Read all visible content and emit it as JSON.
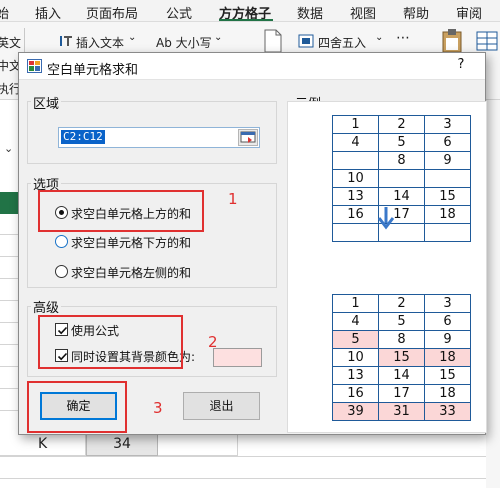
{
  "ribbon": {
    "tabs": [
      "始",
      "插入",
      "页面布局",
      "公式",
      "方方格子",
      "数据",
      "视图",
      "帮助",
      "审阅"
    ],
    "active_tab": "方方格子",
    "buttons": {
      "insert_text": "插入文本",
      "case": "Ab 大小写",
      "round": "四舍五入"
    },
    "left_labels": [
      "英文",
      "中文",
      "执行"
    ]
  },
  "sheet": {
    "cell_label": "K",
    "cell_value": "34"
  },
  "dialog": {
    "title": "空白单元格求和",
    "help": "?",
    "range_group_label": "区域",
    "range_value": "C2:C12",
    "options_group_label": "选项",
    "options": [
      {
        "label": "求空白单元格上方的和",
        "selected": true
      },
      {
        "label": "求空白单元格下方的和",
        "selected": false
      },
      {
        "label": "求空白单元格左侧的和",
        "selected": false
      }
    ],
    "advanced_group_label": "高级",
    "use_formula_label": "使用公式",
    "use_formula_checked": true,
    "set_bg_label": "同时设置其背景颜色为:",
    "set_bg_checked": true,
    "bg_color": "#fde0e0",
    "ok_label": "确定",
    "cancel_label": "退出",
    "example_label": "示例",
    "annotations": [
      "1",
      "2",
      "3"
    ]
  },
  "example": {
    "before": [
      [
        "1",
        "2",
        "3"
      ],
      [
        "4",
        "5",
        "6"
      ],
      [
        "",
        "8",
        "9"
      ],
      [
        "10",
        "",
        ""
      ],
      [
        "13",
        "14",
        "15"
      ],
      [
        "16",
        "17",
        "18"
      ],
      [
        "",
        "",
        ""
      ]
    ],
    "after": [
      [
        "1",
        "2",
        "3"
      ],
      [
        "4",
        "5",
        "6"
      ],
      [
        "5",
        "8",
        "9"
      ],
      [
        "10",
        "15",
        "18"
      ],
      [
        "13",
        "14",
        "15"
      ],
      [
        "16",
        "17",
        "18"
      ],
      [
        "39",
        "31",
        "33"
      ]
    ],
    "highlighted_cells": [
      [
        2,
        0
      ],
      [
        3,
        1
      ],
      [
        3,
        2
      ],
      [
        6,
        0
      ],
      [
        6,
        1
      ],
      [
        6,
        2
      ]
    ],
    "highlight_color": "#fbd7d7"
  }
}
